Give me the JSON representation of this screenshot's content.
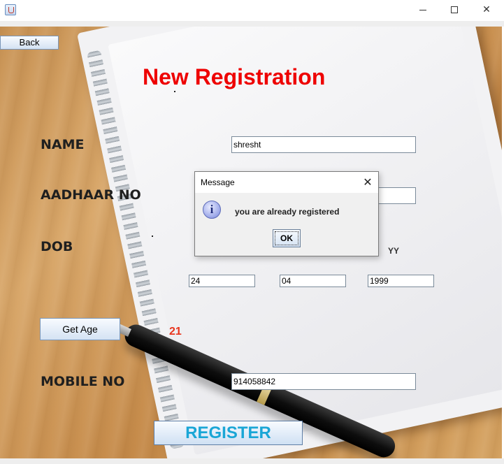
{
  "window": {
    "minimize_glyph": "",
    "close_glyph": "✕",
    "app_icon": "java-coffee-cup-icon"
  },
  "form": {
    "back_label": "Back",
    "title": "New Registration",
    "name_label": "NAME",
    "aadhaar_label": "AADHAAR NO",
    "dob_label": "DOB",
    "yy_label": "YY",
    "mobile_label": "MOBILE NO",
    "name_value": "shresht",
    "aadhaar_value": "",
    "dob_day": "24",
    "dob_month": "04",
    "dob_year": "1999",
    "get_age_label": "Get Age",
    "age_value": "21",
    "mobile_value": "914058842",
    "register_label": "REGISTER"
  },
  "dialog": {
    "title": "Message",
    "close_glyph": "✕",
    "icon_glyph": "i",
    "message": "you are already registered",
    "ok_label": "OK"
  },
  "colors": {
    "title_red": "#ee0000",
    "age_red": "#e8341c",
    "register_text": "#1aa6d6"
  }
}
